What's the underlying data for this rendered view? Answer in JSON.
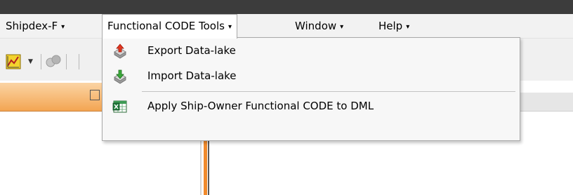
{
  "menubar": {
    "items": [
      {
        "label": "Shipdex-F",
        "arrow": "▾"
      },
      {
        "label": "Functional CODE Tools",
        "arrow": "▾"
      },
      {
        "label": "Window",
        "arrow": "▾"
      },
      {
        "label": "Help",
        "arrow": "▾"
      }
    ]
  },
  "dropdown": {
    "items": [
      {
        "label": "Export Data-lake",
        "icon": "export-icon"
      },
      {
        "label": "Import Data-lake",
        "icon": "import-icon"
      },
      {
        "label": "Apply Ship-Owner Functional CODE to DML",
        "icon": "spreadsheet-icon"
      }
    ]
  },
  "colors": {
    "titlebar": "#3c3c3c",
    "menubar": "#f2f2f2",
    "panel_accent": "#f08a2c"
  }
}
